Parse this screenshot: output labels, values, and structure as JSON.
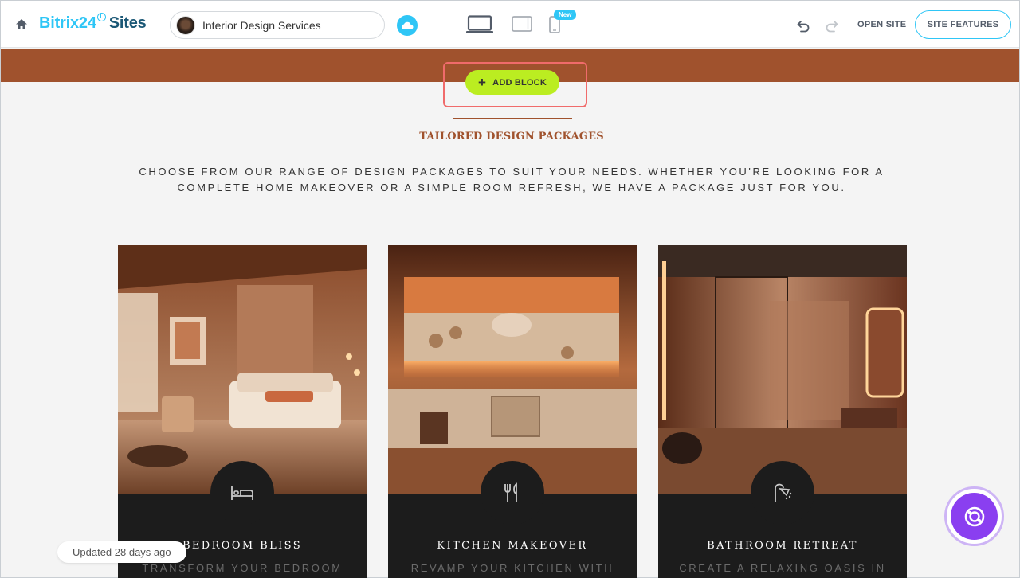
{
  "header": {
    "brand_primary": "Bitrix24",
    "brand_secondary": "Sites",
    "site_name": "Interior Design Services",
    "new_badge": "New",
    "open_site_label": "OPEN SITE",
    "site_features_label": "SITE FEATURES",
    "icons": [
      "home-icon",
      "cloud-icon",
      "desktop-icon",
      "tablet-icon",
      "mobile-icon",
      "undo-icon",
      "redo-icon"
    ]
  },
  "editor": {
    "add_block_label": "ADD BLOCK",
    "updated_label": "Updated 28 days ago"
  },
  "section": {
    "title": "TAILORED DESIGN PACKAGES",
    "description": "CHOOSE FROM OUR RANGE OF DESIGN PACKAGES TO SUIT YOUR NEEDS. WHETHER YOU'RE LOOKING FOR A COMPLETE HOME MAKEOVER OR A SIMPLE ROOM REFRESH, WE HAVE A PACKAGE JUST FOR YOU.",
    "cards": [
      {
        "title": "BEDROOM BLISS",
        "subtitle": "TRANSFORM YOUR BEDROOM",
        "icon": "bed-icon"
      },
      {
        "title": "KITCHEN MAKEOVER",
        "subtitle": "REVAMP YOUR KITCHEN WITH",
        "icon": "utensils-icon"
      },
      {
        "title": "BATHROOM RETREAT",
        "subtitle": "CREATE A RELAXING OASIS IN",
        "icon": "shower-icon"
      }
    ]
  },
  "colors": {
    "accent": "#2fc6f6",
    "brand_dark": "#1b5876",
    "band": "#a0522d",
    "add_block": "#bbed21",
    "highlight": "#f06b6b",
    "card_bg": "#1c1c1c",
    "assistant": "#8a3ff0"
  }
}
